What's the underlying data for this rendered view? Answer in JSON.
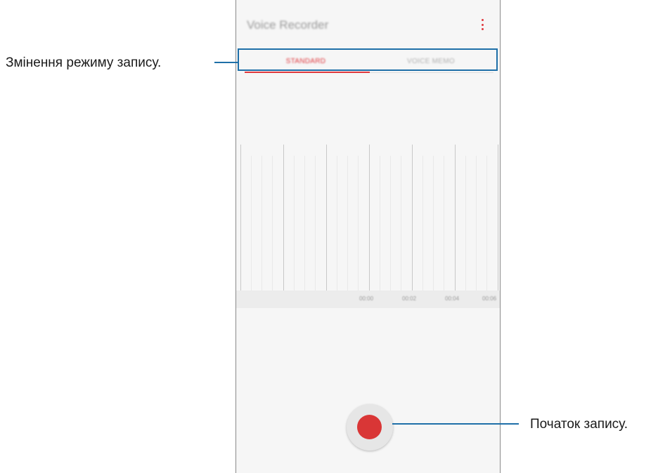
{
  "app": {
    "title": "Voice Recorder",
    "more_icon": "more-vertical-icon"
  },
  "tabs": [
    {
      "label": "STANDARD",
      "selected": true
    },
    {
      "label": "VOICE MEMO",
      "selected": false
    }
  ],
  "timeline": {
    "labels": [
      "00:00",
      "00:02",
      "00:04",
      "00:06"
    ]
  },
  "record": {
    "icon": "record-icon"
  },
  "callouts": {
    "mode": "Змінення режиму запису.",
    "record": "Початок запису."
  },
  "colors": {
    "accent": "#e0393e",
    "callout": "#1e6fa8",
    "record": "#d93636"
  }
}
